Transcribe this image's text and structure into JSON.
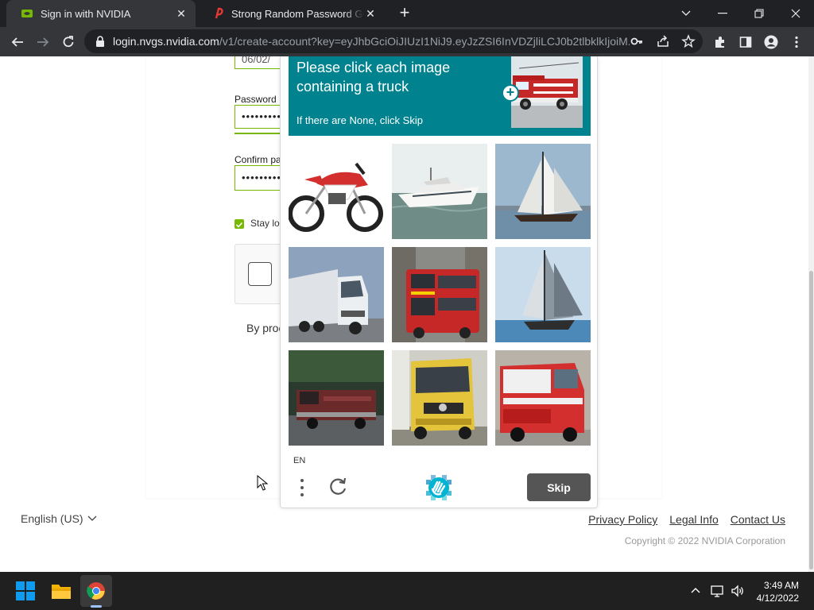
{
  "browser": {
    "tabs": [
      {
        "title": "Sign in with NVIDIA",
        "active": true
      },
      {
        "title": "Strong Random Password Generator",
        "active": false
      }
    ],
    "url_host": "login.nvgs.nvidia.com",
    "url_path": "/v1/create-account?key=eyJhbGciOiJIUzI1NiJ9.eyJzZSI6InVDZjliLCJ0b2tlbklkIjoiM..."
  },
  "form": {
    "date_value": "06/02/",
    "password_label": "Password",
    "password_value": "•••••••••",
    "confirm_label": "Confirm pa",
    "confirm_value": "•••••••••",
    "stay_label": "Stay lo",
    "byproc_text": "By proc"
  },
  "captcha": {
    "prompt": "Please click each image containing a truck",
    "subprompt": "If there are None, click Skip",
    "example_subject": "fire truck",
    "tiles": [
      {
        "subject": "motorcycle"
      },
      {
        "subject": "yacht"
      },
      {
        "subject": "sailboat"
      },
      {
        "subject": "semi truck"
      },
      {
        "subject": "double-decker bus"
      },
      {
        "subject": "sailboat"
      },
      {
        "subject": "fire truck"
      },
      {
        "subject": "yellow truck"
      },
      {
        "subject": "fire truck"
      }
    ],
    "language": "EN",
    "skip_label": "Skip"
  },
  "footer": {
    "language": "English (US)",
    "links": [
      "Privacy Policy",
      "Legal Info",
      "Contact Us"
    ],
    "copyright": "Copyright © 2022 NVIDIA Corporation"
  },
  "taskbar": {
    "time": "3:49 AM",
    "date": "4/12/2022"
  },
  "colors": {
    "nvidia_green": "#76b900",
    "captcha_teal": "#00838f",
    "skip_gray": "#555555"
  }
}
